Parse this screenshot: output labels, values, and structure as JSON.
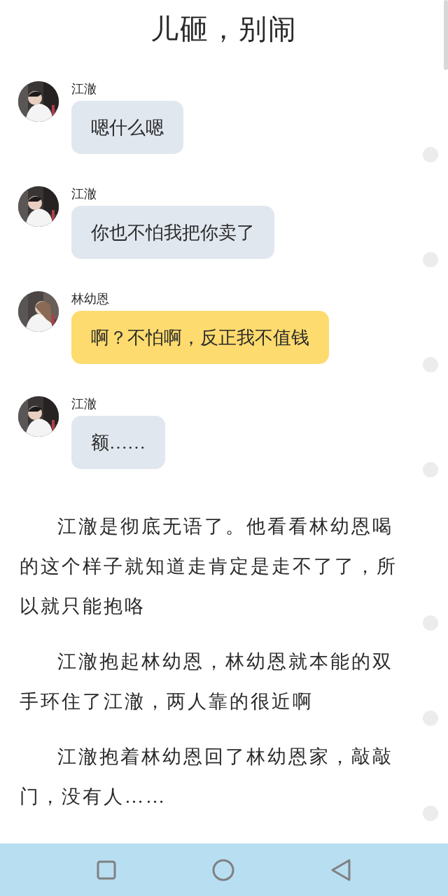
{
  "title": "儿砸，别闹",
  "messages": [
    {
      "name": "江澈",
      "text": "嗯什么嗯",
      "highlighted": false
    },
    {
      "name": "江澈",
      "text": "你也不怕我把你卖了",
      "highlighted": false
    },
    {
      "name": "林幼恩",
      "text": "啊？不怕啊，反正我不值钱",
      "highlighted": true
    },
    {
      "name": "江澈",
      "text": "额……",
      "highlighted": false
    }
  ],
  "paragraphs": [
    "江澈是彻底无语了。他看看林幼恩喝的这个样子就知道走肯定是走不了了，所以就只能抱咯",
    "江澈抱起林幼恩，林幼恩就本能的双手环住了江澈，两人靠的很近啊",
    "江澈抱着林幼恩回了林幼恩家，敲敲门，没有人……"
  ]
}
